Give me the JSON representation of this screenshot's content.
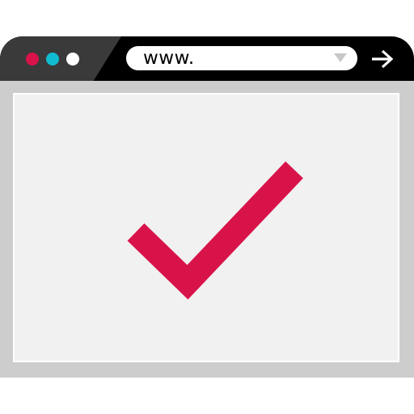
{
  "address_bar": {
    "text": "www."
  },
  "icons": {
    "window_dots": [
      "red-dot-icon",
      "teal-dot-icon",
      "white-dot-icon"
    ],
    "dropdown": "chevron-down-icon",
    "go": "arrow-right-icon",
    "content": "checkmark-icon"
  },
  "colors": {
    "dot_red": "#d8134a",
    "dot_teal": "#10bcd0",
    "dot_white": "#ffffff",
    "checkmark": "#d8134a",
    "titlebar": "#000000",
    "titlebar_left": "#3a3a3a",
    "frame": "#cdcdcd",
    "content_bg": "#f1f1f1"
  }
}
